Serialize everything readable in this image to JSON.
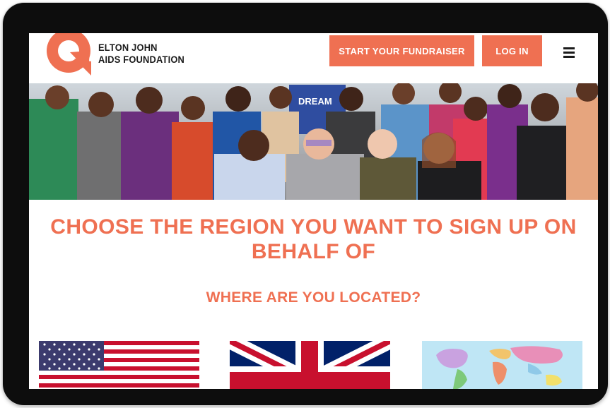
{
  "brand": {
    "name_line1": "ELTON JOHN",
    "name_line2": "AIDS FOUNDATION",
    "accent_color": "#ef7052"
  },
  "header": {
    "fundraiser_label": "START YOUR FUNDRAISER",
    "login_label": "LOG IN",
    "menu_icon": "hamburger-menu-icon"
  },
  "hero": {
    "banner_text": "DREAM"
  },
  "main": {
    "title": "CHOOSE THE REGION YOU WANT TO SIGN UP ON BEHALF OF",
    "subtitle": "WHERE ARE YOU LOCATED?"
  },
  "regions": [
    {
      "icon": "us-flag-icon"
    },
    {
      "icon": "uk-flag-icon"
    },
    {
      "icon": "world-map-icon"
    }
  ]
}
